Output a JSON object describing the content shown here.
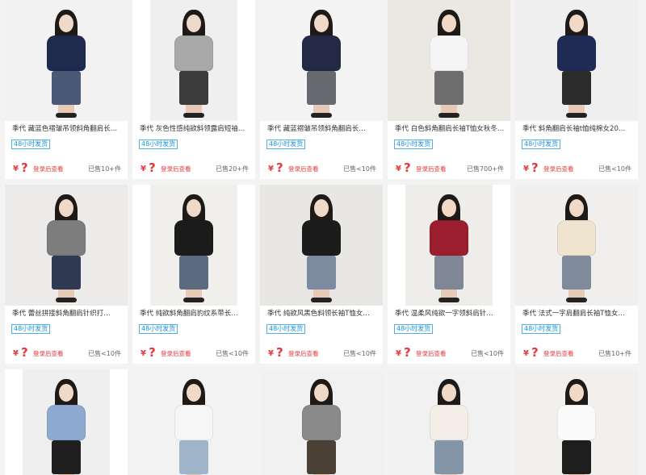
{
  "products": [
    {
      "title": "季代 藏蓝色褶皱吊领斜角翻肩长…",
      "badge": "48小时发货",
      "currency": "¥",
      "price_hidden": "?",
      "login_tip": "登录后查看",
      "sold": "已售10+件",
      "top": "#1f2a4e",
      "bottom": "#4a5a76",
      "bg": "#f2f2f2"
    },
    {
      "title": "季代 灰色性感纯欲斜领露肩短袖…",
      "badge": "48小时发货",
      "currency": "¥",
      "price_hidden": "?",
      "login_tip": "登录后查看",
      "sold": "已售20+件",
      "top": "#a8a8a8",
      "bottom": "#3b3b3b",
      "bg": "#efefef"
    },
    {
      "title": "季代 藏蓝褶皱吊领斜角翻肩长…",
      "badge": "48小时发货",
      "currency": "¥",
      "price_hidden": "?",
      "login_tip": "登录后查看",
      "sold": "已售<10件",
      "top": "#222a45",
      "bottom": "#666a70",
      "bg": "#f4f4f4"
    },
    {
      "title": "季代 白色斜角翻肩长袖T恤女秋冬…",
      "badge": "48小时发货",
      "currency": "¥",
      "price_hidden": "?",
      "login_tip": "登录后查看",
      "sold": "已售700+件",
      "top": "#f5f5f5",
      "bottom": "#6e6e6e",
      "bg": "#ebe8e4"
    },
    {
      "title": "季代 斜角翻肩长袖t恤纯棉女20…",
      "badge": "48小时发货",
      "currency": "¥",
      "price_hidden": "?",
      "login_tip": "登录后查看",
      "sold": "已售<10件",
      "top": "#1f2b55",
      "bottom": "#2b2b2b",
      "bg": "#efefef"
    },
    {
      "title": "季代 蕾丝拼接斜角翻肩针织打…",
      "badge": "48小时发货",
      "currency": "¥",
      "price_hidden": "?",
      "login_tip": "登录后查看",
      "sold": "已售<10件",
      "top": "#7d7d7d",
      "bottom": "#2f3a52",
      "bg": "#ecebe9"
    },
    {
      "title": "季代 纯欲斜角翻肩豹纹系带长…",
      "badge": "48小时发货",
      "currency": "¥",
      "price_hidden": "?",
      "login_tip": "登录后查看",
      "sold": "已售<10件",
      "top": "#1b1b1b",
      "bottom": "#5b6a80",
      "bg": "#f0efec"
    },
    {
      "title": "季代 纯欲风黑色斜领长袖T恤女…",
      "badge": "48小时发货",
      "currency": "¥",
      "price_hidden": "?",
      "login_tip": "登录后查看",
      "sold": "已售<10件",
      "top": "#1c1c1c",
      "bottom": "#7d8aa0",
      "bg": "#e9e7e3"
    },
    {
      "title": "季代 温柔风纯欲一字领斜肩针…",
      "badge": "48小时发货",
      "currency": "¥",
      "price_hidden": "?",
      "login_tip": "登录后查看",
      "sold": "已售<10件",
      "top": "#9b1e2e",
      "bottom": "#7f8795",
      "bg": "#efedea"
    },
    {
      "title": "季代 法式一字肩翻肩长袖T恤女…",
      "badge": "48小时发货",
      "currency": "¥",
      "price_hidden": "?",
      "login_tip": "登录后查看",
      "sold": "已售10+件",
      "top": "#efe4cf",
      "bottom": "#7f8b9a",
      "bg": "#f1efed"
    },
    {
      "title": "",
      "badge": "",
      "currency": "",
      "price_hidden": "",
      "login_tip": "",
      "sold": "",
      "top": "#8eaad0",
      "bottom": "#1f1f1f",
      "bg": "#efefef"
    },
    {
      "title": "",
      "badge": "",
      "currency": "",
      "price_hidden": "",
      "login_tip": "",
      "sold": "",
      "top": "#f6f6f6",
      "bottom": "#9fb3c9",
      "bg": "#f3f3f3"
    },
    {
      "title": "",
      "badge": "",
      "currency": "",
      "price_hidden": "",
      "login_tip": "",
      "sold": "",
      "top": "#8a8a8a",
      "bottom": "#4a4035",
      "bg": "#f1f1f1"
    },
    {
      "title": "",
      "badge": "",
      "currency": "",
      "price_hidden": "",
      "login_tip": "",
      "sold": "",
      "top": "#f3efe8",
      "bottom": "#8495a8",
      "bg": "#f1f1f1"
    },
    {
      "title": "",
      "badge": "",
      "currency": "",
      "price_hidden": "",
      "login_tip": "",
      "sold": "",
      "top": "#fafafa",
      "bottom": "#1e1e1e",
      "bg": "#f2f0ed"
    }
  ]
}
